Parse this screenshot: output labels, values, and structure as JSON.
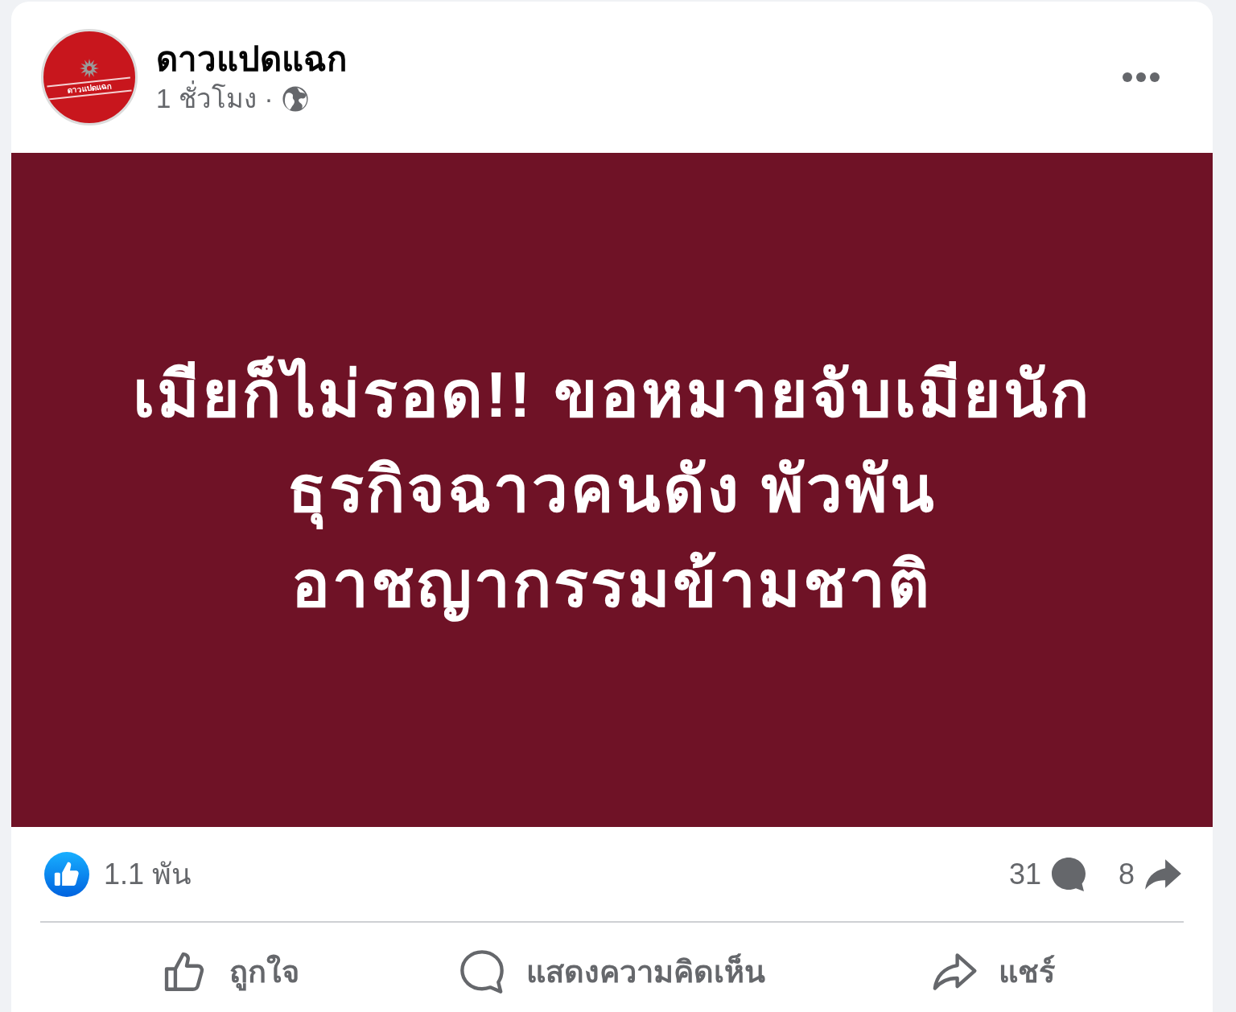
{
  "header": {
    "avatar": {
      "logo_text": "ดาวแปดแฉก"
    },
    "author": "ดาวแปดแฉก",
    "time": "1 ชั่วโมง",
    "separator": "·"
  },
  "content": {
    "lines": [
      "เมียก็ไม่รอด!! ขอหมายจับเมียนัก",
      "ธุรกิจฉาวคนดัง พัวพัน",
      "อาชญากรรมข้ามชาติ"
    ]
  },
  "stats": {
    "reactions": "1.1 พัน",
    "comments": "31",
    "shares": "8"
  },
  "actions": [
    {
      "kind": "like",
      "label": "ถูกใจ"
    },
    {
      "kind": "comment",
      "label": "แสดงความคิดเห็น"
    },
    {
      "kind": "share",
      "label": "แชร์"
    }
  ]
}
